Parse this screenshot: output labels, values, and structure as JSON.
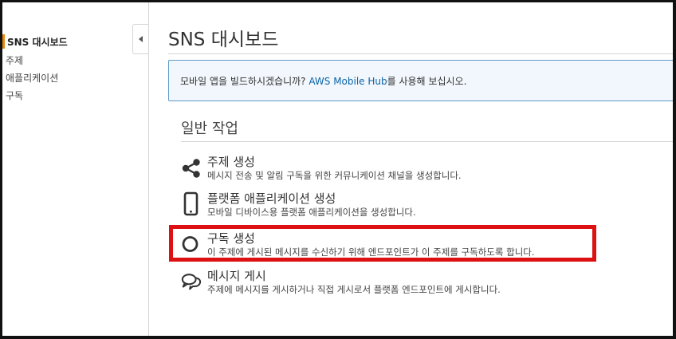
{
  "sidebar": {
    "items": [
      {
        "label": "SNS 대시보드",
        "active": true
      },
      {
        "label": "주제",
        "active": false
      },
      {
        "label": "애플리케이션",
        "active": false
      },
      {
        "label": "구독",
        "active": false
      }
    ],
    "collapse_icon": "chevron-left-icon"
  },
  "header": {
    "title": "SNS 대시보드"
  },
  "info": {
    "text_before": "모바일 앱을 빌드하시겠습니까? ",
    "link": "AWS Mobile Hub",
    "text_after": "를 사용해 보십시오."
  },
  "section": {
    "title": "일반 작업"
  },
  "tasks": [
    {
      "icon": "share-icon",
      "title": "주제 생성",
      "description": "메시지 전송 및 알림 구독을 위한 커뮤니케이션 채널을 생성합니다."
    },
    {
      "icon": "mobile-phone-icon",
      "title": "플랫폼 애플리케이션 생성",
      "description": "모바일 디바이스용 플랫폼 애플리케이션을 생성합니다."
    },
    {
      "icon": "circle-icon",
      "title": "구독 생성",
      "description": "이 주제에 게시된 메시지를 수신하기 위해 엔드포인트가 이 주제를 구독하도록 합니다."
    },
    {
      "icon": "speech-bubbles-icon",
      "title": "메시지 게시",
      "description": "주제에 메시지를 게시하거나 직접 게시로서 플랫폼 엔드포인트에 게시합니다."
    }
  ],
  "colors": {
    "accent": "#e8880f",
    "link": "#0b63a8",
    "info_border": "#5e9bc9",
    "info_bg": "#f1f7fc",
    "highlight": "#dd1111"
  }
}
